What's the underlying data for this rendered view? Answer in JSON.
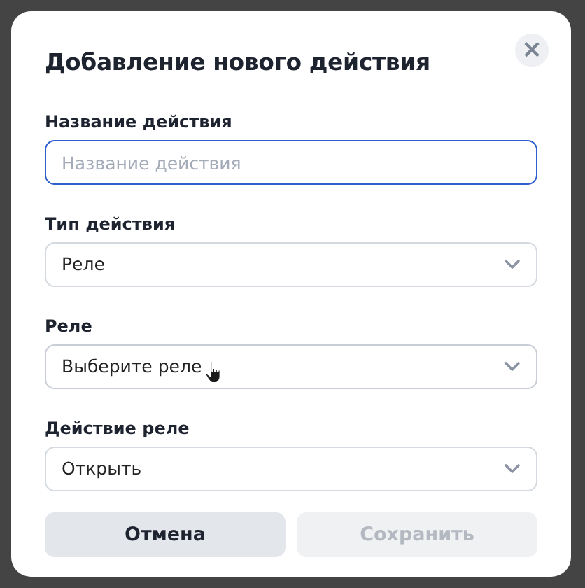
{
  "dialog": {
    "title": "Добавление нового действия",
    "close_label": "×"
  },
  "fields": [
    {
      "kind": "text",
      "label": "Название действия",
      "placeholder": "Название действия",
      "focused": true
    },
    {
      "kind": "select",
      "label": "Тип действия",
      "value": "Реле",
      "hovered": false
    },
    {
      "kind": "select",
      "label": "Реле",
      "value": "Выберите реле",
      "hovered": true
    },
    {
      "kind": "select",
      "label": "Действие реле",
      "value": "Открыть",
      "hovered": false
    }
  ],
  "buttons": [
    {
      "kind": "cancel",
      "label": "Отмена",
      "disabled": false
    },
    {
      "kind": "save",
      "label": "Сохранить",
      "disabled": true
    }
  ]
}
